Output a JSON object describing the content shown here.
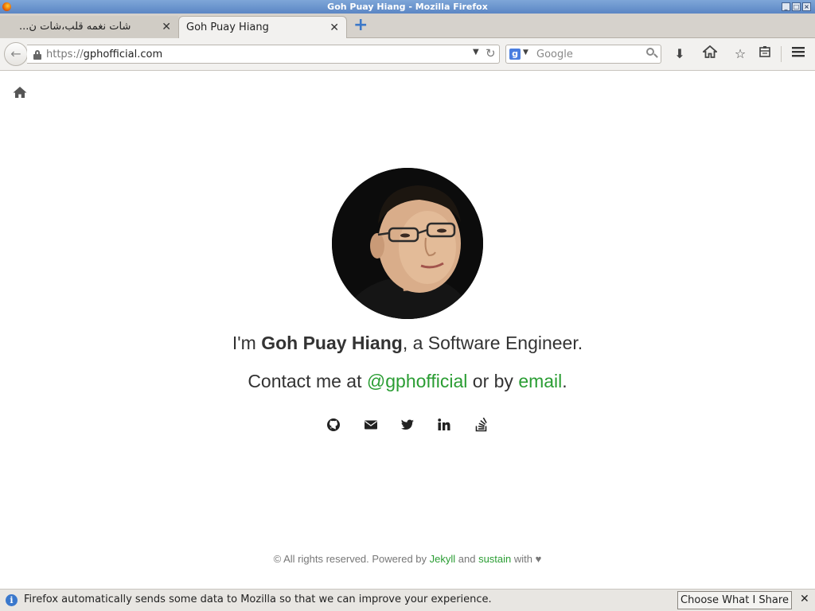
{
  "window": {
    "title": "Goh Puay Hiang - Mozilla Firefox"
  },
  "tabs": [
    {
      "label": "شات نغمه قلب،شات ن..."
    },
    {
      "label": "Goh Puay Hiang"
    }
  ],
  "urlbar": {
    "scheme": "https://",
    "host": "gphofficial.com"
  },
  "search": {
    "engine_letter": "g",
    "placeholder": "Google"
  },
  "page": {
    "intro_prefix": "I'm ",
    "name": "Goh Puay Hiang",
    "intro_suffix": ", a Software Engineer.",
    "contact_prefix": "Contact me at ",
    "twitter_handle": "@gphofficial",
    "contact_mid": " or by ",
    "email_link": "email",
    "contact_end": ".",
    "socials": [
      "github-icon",
      "envelope-icon",
      "twitter-icon",
      "linkedin-icon",
      "stackoverflow-icon"
    ],
    "footer_prefix": "© All rights reserved. Powered by ",
    "footer_jekyll": "Jekyll",
    "footer_and": " and ",
    "footer_sustain": "sustain",
    "footer_with": " with ♥"
  },
  "notification": {
    "text": "Firefox automatically sends some data to Mozilla so that we can improve your experience.",
    "button": "Choose What I Share"
  },
  "colors": {
    "link": "#2a9d33",
    "titlebar": "#6a94cf"
  }
}
